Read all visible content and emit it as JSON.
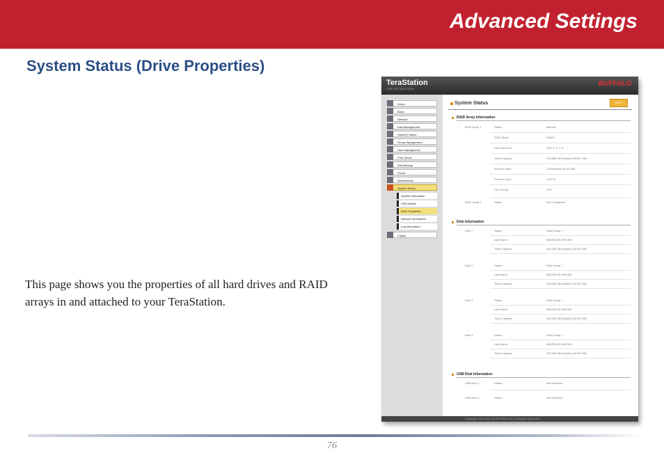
{
  "header": {
    "title": "Advanced Settings"
  },
  "section": {
    "title": "System Status (Drive Properties)"
  },
  "body": {
    "text": "This page shows you the properties of all hard drives and RAID arrays in and attached to your TeraStation."
  },
  "footer": {
    "page_number": "76"
  },
  "screenshot": {
    "logo": "TeraStation",
    "tagline": "FOR LIFE SOLUTION",
    "brand": "BUFFALO",
    "title": "System Status",
    "help": "HELP",
    "copyright": "Copyright 2002-2007 IO BUFFALO INC. All Rights Reserved.",
    "nav": [
      "Home",
      "Basic",
      "Network",
      "Disk Management",
      "Shared Folders",
      "Group Management",
      "User Management",
      "Print Server",
      "Disk Backup",
      "PCast",
      "Maintenance",
      "System Status"
    ],
    "subnav": [
      "System Information",
      "USB Details",
      "Drive Properties",
      "Network Information",
      "Log Information"
    ],
    "logout": "Logout",
    "raid": {
      "heading": "RAID Array Information",
      "array1_label": "RAID Array 1",
      "array2_label": "RAID Array 2",
      "rows": [
        {
          "key": "Status",
          "value": "Normal"
        },
        {
          "key": "RAID Mode",
          "value": "RAID5"
        },
        {
          "key": "Disk Structure",
          "value": "Disk 1, 2, 3, 4"
        },
        {
          "key": "Total Capacity",
          "value": "729,588,352 kbytes (695.81 GB)"
        },
        {
          "key": "Amount Used",
          "value": "4,936 kbytes (0.00 GB)"
        },
        {
          "key": "Percent Used",
          "value": "0.00 %"
        },
        {
          "key": "File Format",
          "value": "XFS"
        }
      ],
      "array2_status_key": "Status",
      "array2_status": "Not Configured"
    },
    "disk": {
      "heading": "Disk Information",
      "disks": [
        {
          "label": "Disk 1",
          "status": "RAID Array 1",
          "unit": "WD2500JS-00HCB1",
          "capacity": "244,198,384 kbytes (232.89 GB)"
        },
        {
          "label": "Disk 2",
          "status": "RAID Array 1",
          "unit": "WD2500JS-00HCB1",
          "capacity": "244,198,384 kbytes (232.89 GB)"
        },
        {
          "label": "Disk 3",
          "status": "RAID Array 1",
          "unit": "WD2500JS-00HCB1",
          "capacity": "244,198,384 kbytes (232.89 GB)"
        },
        {
          "label": "Disk 4",
          "status": "RAID Array 1",
          "unit": "WD2500JS-00HCB1",
          "capacity": "244,198,384 kbytes (232.89 GB)"
        }
      ],
      "status_key": "Status",
      "unit_key": "Unit Name",
      "capacity_key": "Total Capacity"
    },
    "usb": {
      "heading": "USB Disk Information",
      "disks": [
        {
          "label": "USB Disk 1",
          "key": "Status",
          "value": "Not Detected"
        },
        {
          "label": "USB Disk 2",
          "key": "Status",
          "value": "Not Detected"
        }
      ]
    }
  }
}
